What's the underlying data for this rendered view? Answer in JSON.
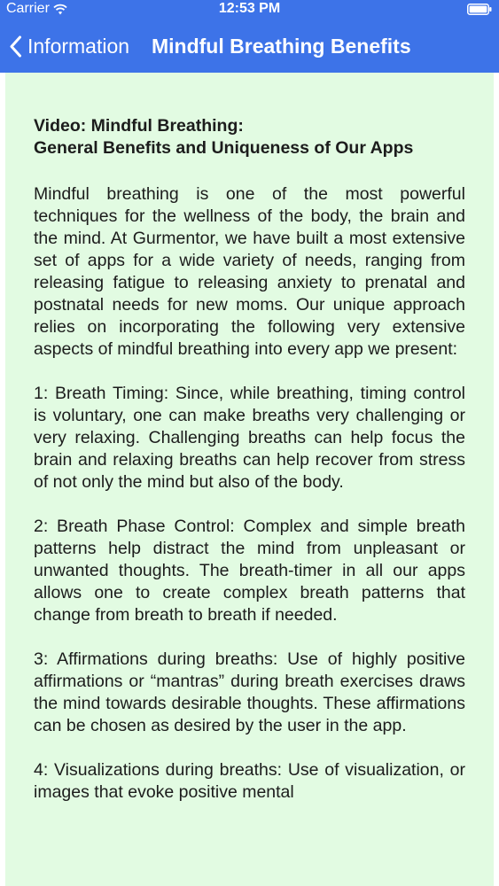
{
  "status_bar": {
    "carrier": "Carrier",
    "time": "12:53 PM",
    "wifi_icon": "wifi-icon",
    "battery_icon": "battery-icon"
  },
  "nav_bar": {
    "back_label": "Information",
    "title": "Mindful Breathing Benefits",
    "color": "#3d73e8"
  },
  "content": {
    "background": "#e2fbe2",
    "heading_line1": "Video: Mindful Breathing:",
    "heading_line2": "General Benefits and Uniqueness of Our Apps",
    "paragraphs": [
      "Mindful breathing is one of the most powerful techniques for the wellness of the body, the brain and the mind. At Gurmentor, we have built a most extensive set of apps for a wide variety of needs, ranging from releasing fatigue to releasing anxiety to prenatal and postnatal needs for new moms. Our unique approach relies on incorporating the following very extensive aspects of mindful breathing into every app we present:",
      "1: Breath Timing: Since, while breathing, timing control is voluntary, one can make breaths very challenging or very relaxing. Challenging breaths can help focus the brain and relaxing breaths can help recover from stress of not only the mind but also of the body.",
      "2: Breath Phase Control: Complex and simple breath patterns help distract the mind from unpleasant or unwanted thoughts. The breath-timer in all our apps allows one to create complex breath patterns that change from breath to breath if needed.",
      "3: Affirmations during breaths: Use of highly positive affirmations or “mantras” during breath exercises draws the mind towards desirable thoughts. These affirmations can be chosen as desired by the user in the app.",
      "4: Visualizations during breaths: Use of visualization, or images that evoke positive mental"
    ]
  }
}
